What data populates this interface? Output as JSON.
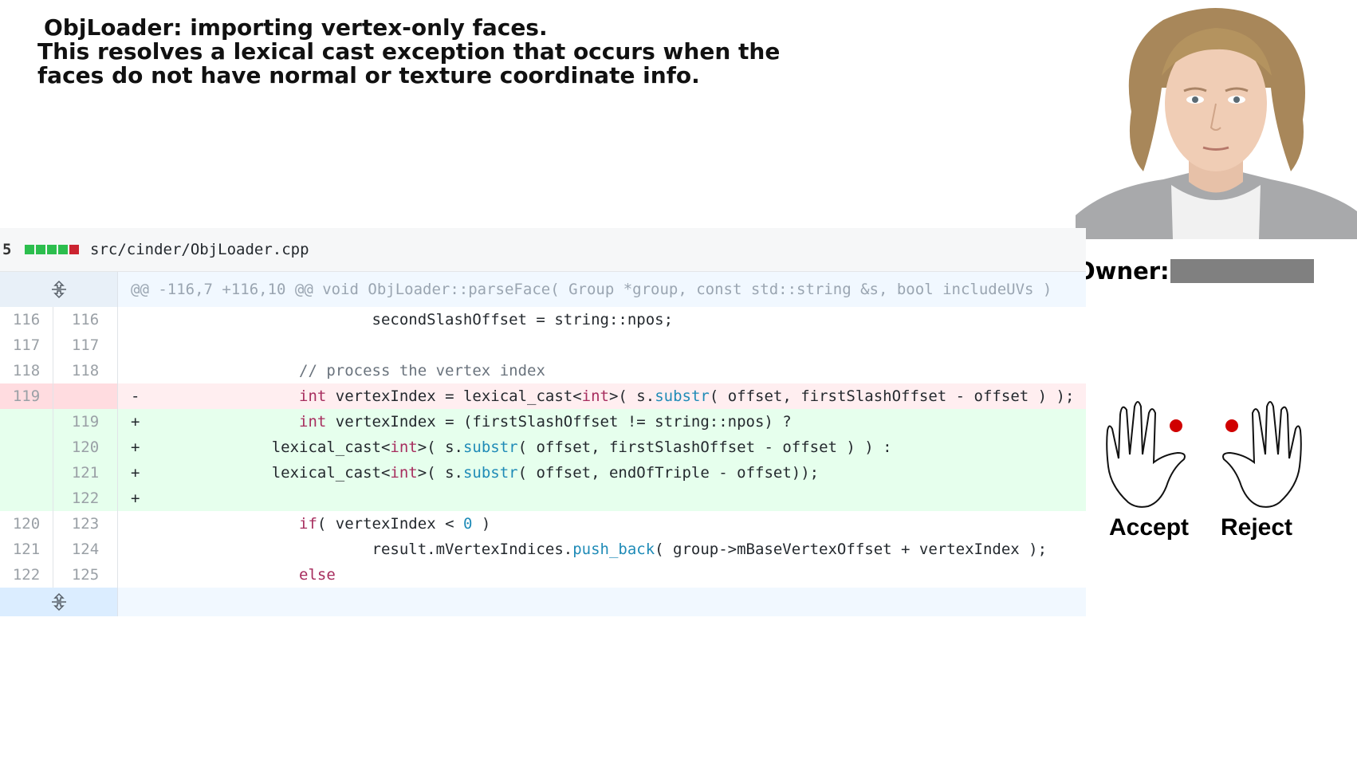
{
  "title": {
    "line1": "ObjLoader: importing vertex-only faces.",
    "line2": "This resolves a lexical cast exception that occurs when the",
    "line3": "faces do not have normal or texture coordinate info."
  },
  "owner": {
    "label": "Owner:"
  },
  "actions": {
    "accept": "Accept",
    "reject": "Reject"
  },
  "colors": {
    "add_bg": "#e6ffed",
    "del_bg": "#ffeef0",
    "owner_redacted": "#808080",
    "finger_dot": "#d00000"
  },
  "diff": {
    "change_count": "5",
    "file_path": "src/cinder/ObjLoader.cpp",
    "hunk_header": "@@ -116,7 +116,10 @@ void ObjLoader::parseFace( Group *group, const std::string &s, bool includeUVs )",
    "lines": [
      {
        "type": "ctx",
        "old": "116",
        "new": "116",
        "sign": "",
        "code": "                        secondSlashOffset = string::npos;"
      },
      {
        "type": "ctx",
        "old": "117",
        "new": "117",
        "sign": "",
        "code": ""
      },
      {
        "type": "ctx",
        "old": "118",
        "new": "118",
        "sign": "",
        "code": "                // process the vertex index"
      },
      {
        "type": "del",
        "old": "119",
        "new": "",
        "sign": "-",
        "code": "                int vertexIndex = lexical_cast<int>( s.substr( offset, firstSlashOffset - offset ) );"
      },
      {
        "type": "add",
        "old": "",
        "new": "119",
        "sign": "+",
        "code": "                int vertexIndex = (firstSlashOffset != string::npos) ?"
      },
      {
        "type": "add",
        "old": "",
        "new": "120",
        "sign": "+",
        "code": "             lexical_cast<int>( s.substr( offset, firstSlashOffset - offset ) ) :"
      },
      {
        "type": "add",
        "old": "",
        "new": "121",
        "sign": "+",
        "code": "             lexical_cast<int>( s.substr( offset, endOfTriple - offset));"
      },
      {
        "type": "add",
        "old": "",
        "new": "122",
        "sign": "+",
        "code": ""
      },
      {
        "type": "ctx",
        "old": "120",
        "new": "123",
        "sign": "",
        "code": "                if( vertexIndex < 0 )"
      },
      {
        "type": "ctx",
        "old": "121",
        "new": "124",
        "sign": "",
        "code": "                        result.mVertexIndices.push_back( group->mBaseVertexOffset + vertexIndex );"
      },
      {
        "type": "ctx",
        "old": "122",
        "new": "125",
        "sign": "",
        "code": "                else"
      }
    ]
  }
}
